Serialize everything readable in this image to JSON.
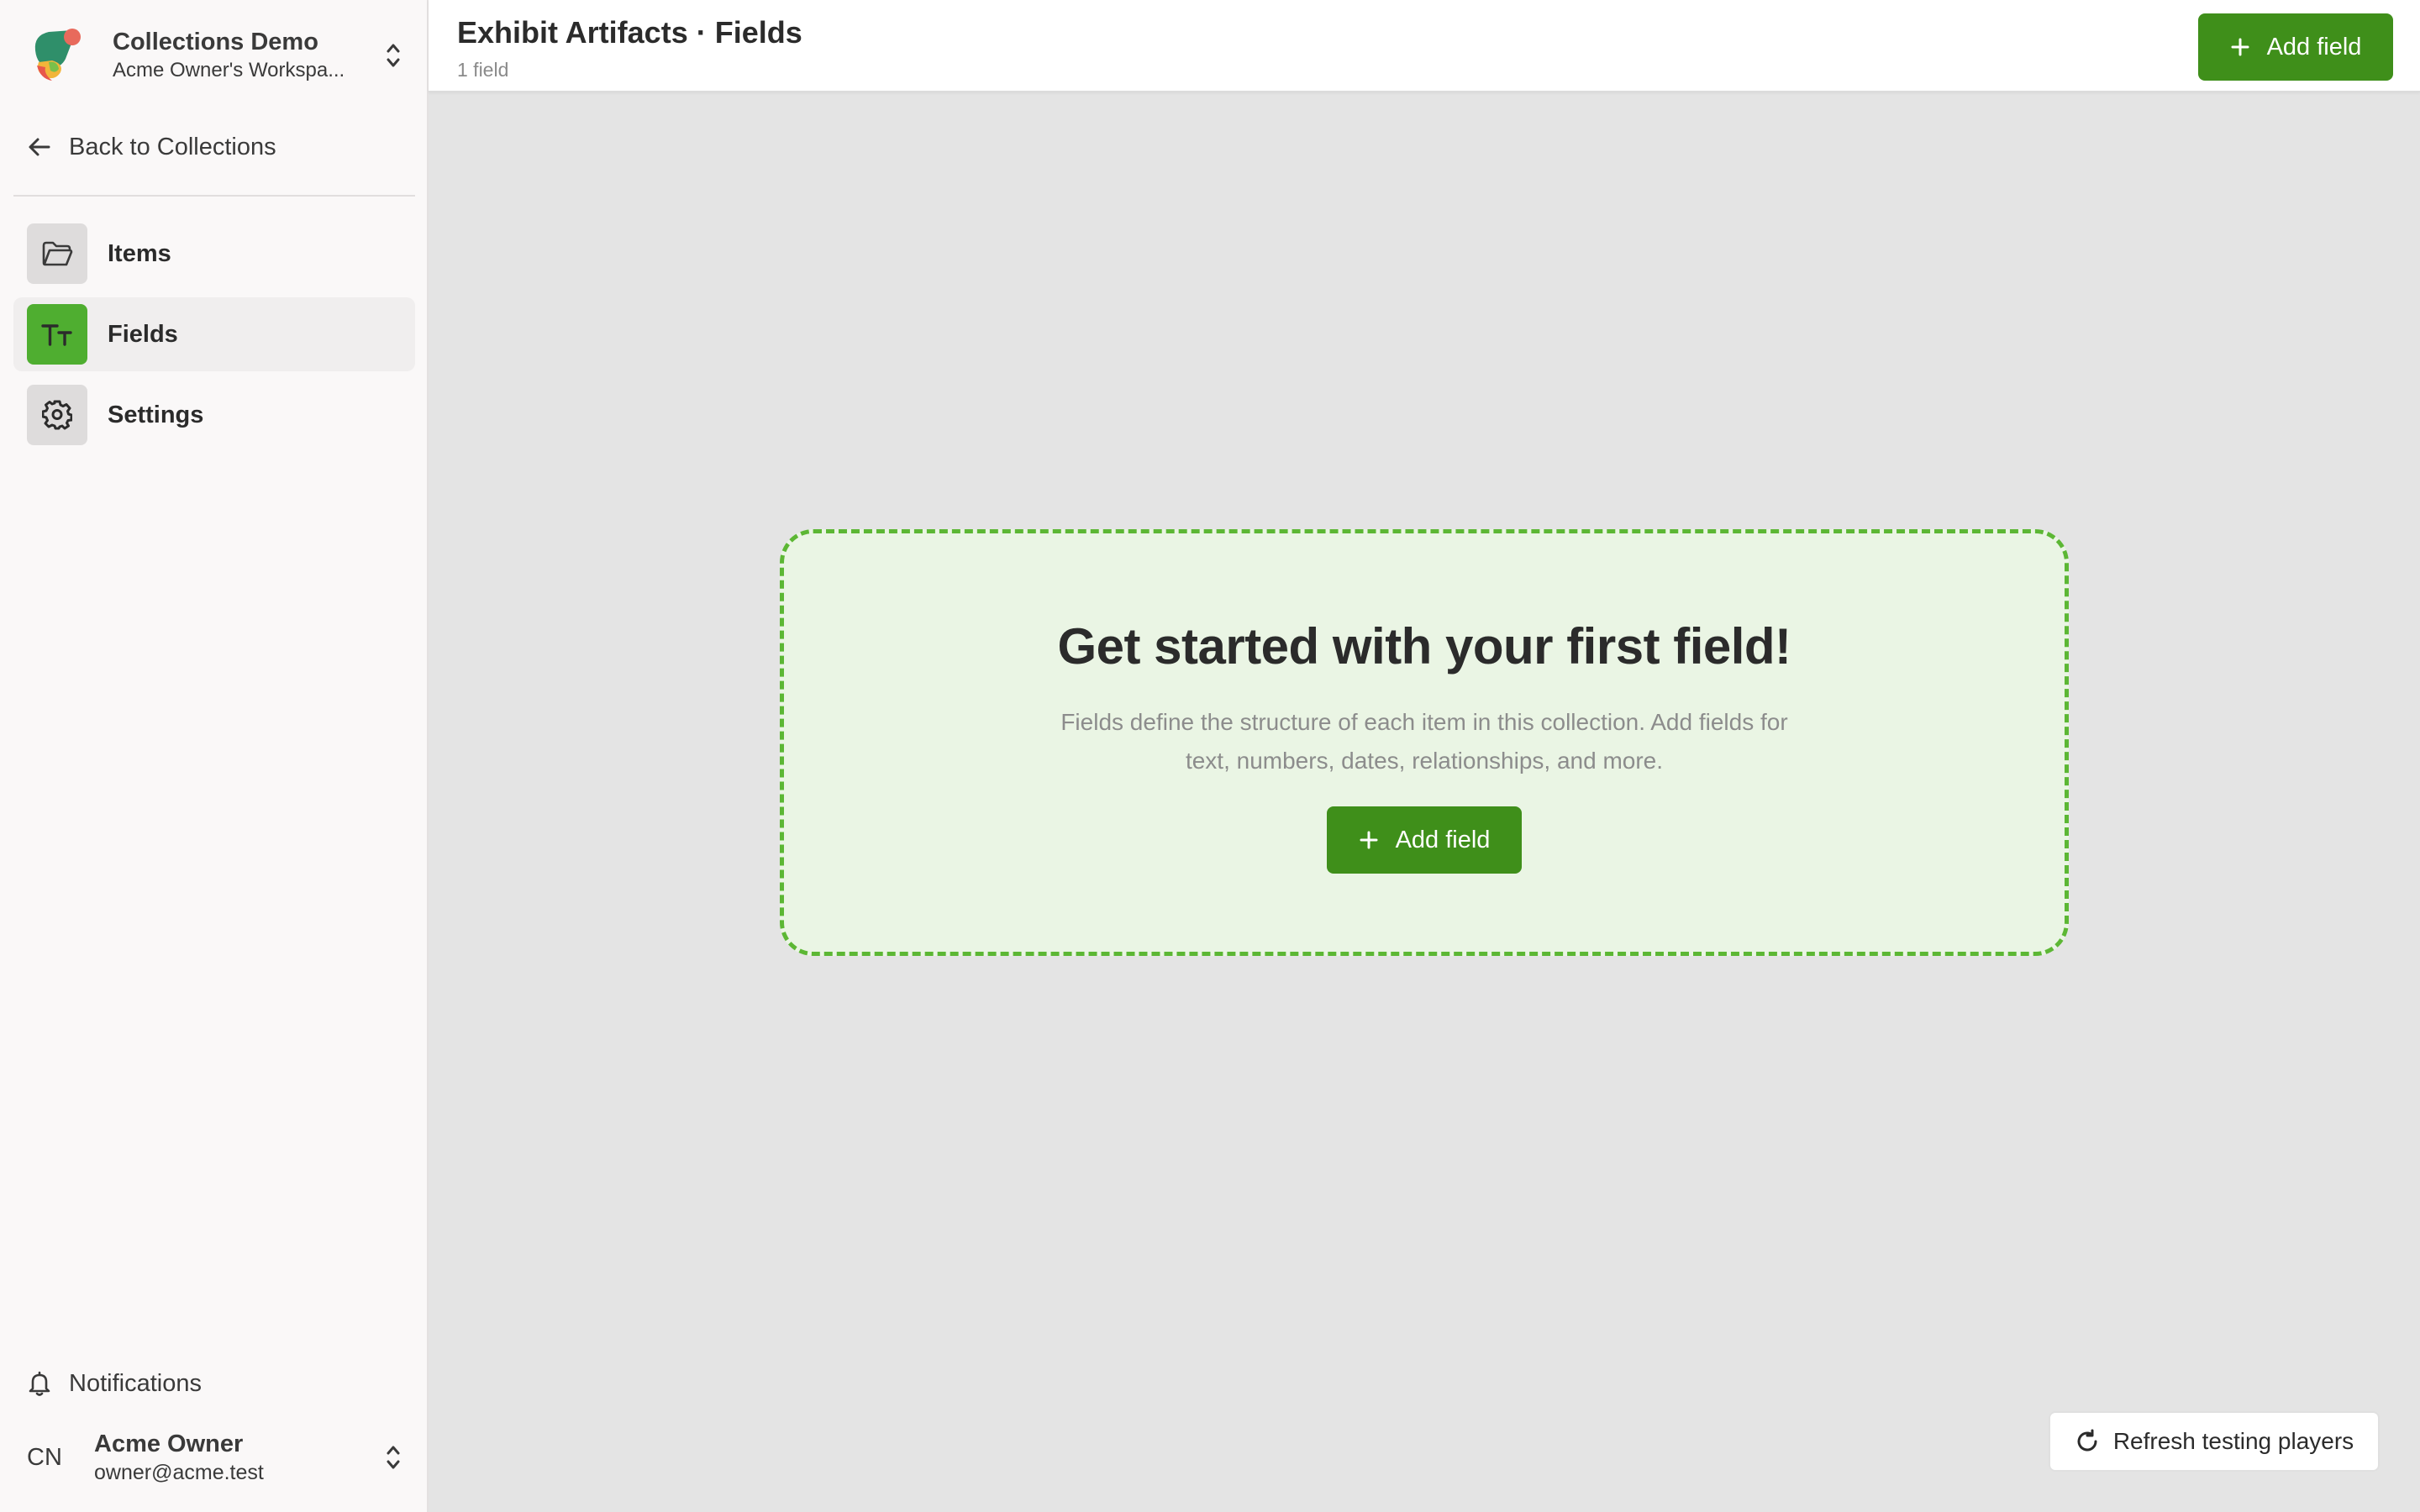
{
  "workspace": {
    "title": "Collections Demo",
    "subtitle": "Acme Owner's Workspa..."
  },
  "sidebar": {
    "back_label": "Back to Collections",
    "items": [
      {
        "label": "Items",
        "icon": "folder-icon"
      },
      {
        "label": "Fields",
        "icon": "text-type-icon",
        "active": true
      },
      {
        "label": "Settings",
        "icon": "gear-icon"
      }
    ],
    "notifications_label": "Notifications",
    "user": {
      "initials": "CN",
      "name": "Acme Owner",
      "email": "owner@acme.test"
    }
  },
  "header": {
    "title": "Exhibit Artifacts · Fields",
    "subtitle": "1 field",
    "add_label": "Add field"
  },
  "empty_state": {
    "title": "Get started with your first field!",
    "description": "Fields define the structure of each item in this collection. Add fields for text, numbers, dates, relationships, and more.",
    "add_label": "Add field"
  },
  "refresh_label": "Refresh testing players",
  "colors": {
    "accent": "#3f8f1a",
    "accent_light": "#4fae30",
    "dashed_border": "#5cb734",
    "empty_bg": "#eaf5e4",
    "main_bg": "#e4e4e4",
    "sidebar_bg": "#faf8f8"
  }
}
